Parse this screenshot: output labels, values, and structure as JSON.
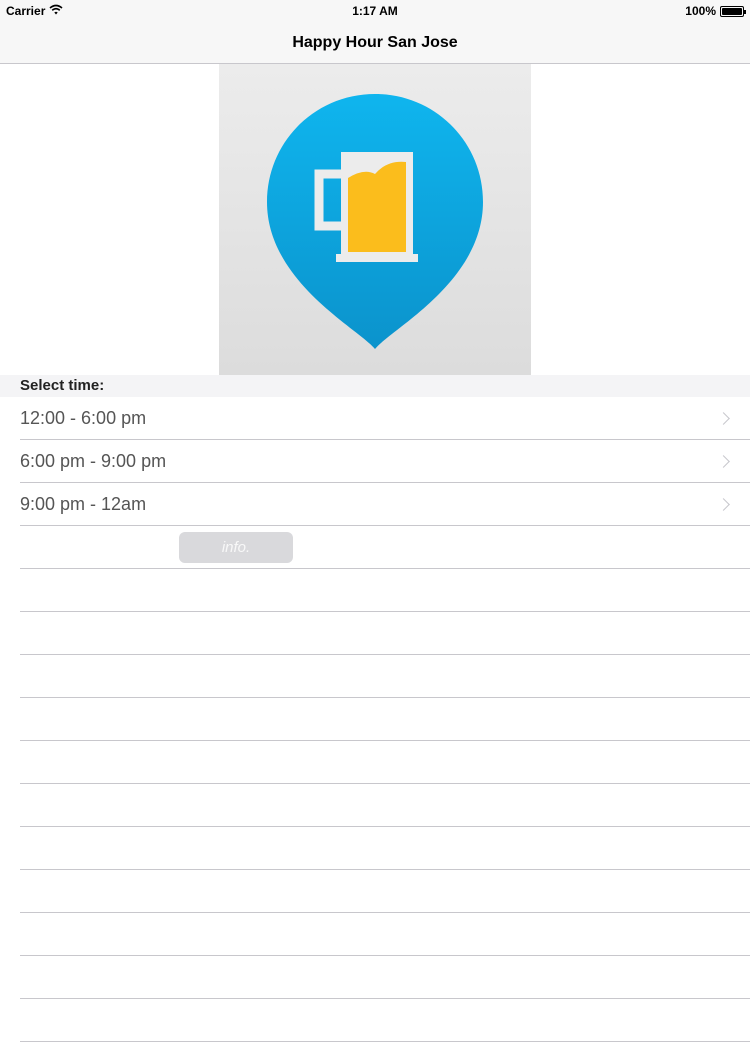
{
  "status_bar": {
    "carrier": "Carrier",
    "time": "1:17 AM",
    "battery": "100%",
    "icons": [
      "wifi-icon",
      "battery-icon"
    ]
  },
  "nav": {
    "title": "Happy Hour San Jose"
  },
  "hero": {
    "icon": "beer-pin-logo",
    "colors": {
      "pin": "#0fa7dd",
      "beer": "#fbbd1c",
      "mug": "#ececec"
    }
  },
  "section": {
    "header": "Select time:"
  },
  "times": [
    {
      "label": "12:00 - 6:00 pm"
    },
    {
      "label": "6:00 pm - 9:00 pm"
    },
    {
      "label": "9:00 pm - 12am"
    }
  ],
  "info_button": {
    "label": "info."
  },
  "empty_rows": 11
}
